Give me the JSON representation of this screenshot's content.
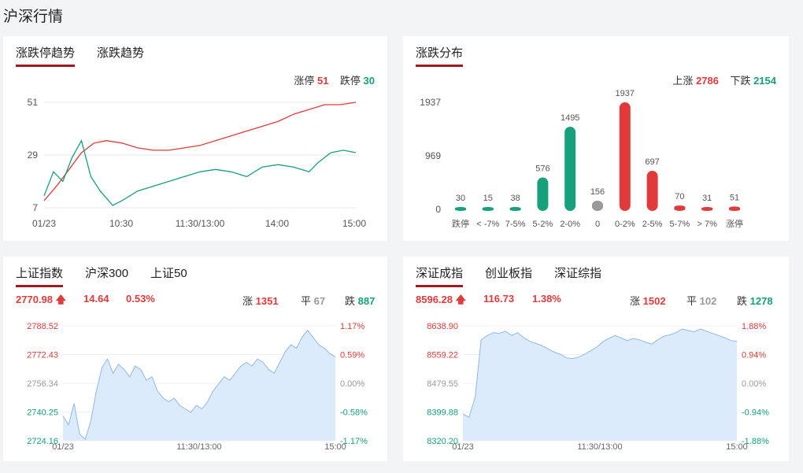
{
  "page_title": "沪深行情",
  "panel1": {
    "tabs": [
      "涨跌停趋势",
      "涨跌趋势"
    ],
    "limit_up_label": "涨停",
    "limit_up_value": "51",
    "limit_down_label": "跌停",
    "limit_down_value": "30",
    "chart_data": {
      "type": "line",
      "yticks": [
        "51",
        "29",
        "7"
      ],
      "xticks": [
        "01/23",
        "10:30",
        "11:30/13:00",
        "14:00",
        "15:00"
      ],
      "ylim": [
        7,
        51
      ],
      "series": [
        {
          "color": "#e03a3a",
          "x": [
            0,
            0.04,
            0.08,
            0.12,
            0.16,
            0.2,
            0.25,
            0.3,
            0.35,
            0.4,
            0.45,
            0.5,
            0.55,
            0.6,
            0.65,
            0.7,
            0.75,
            0.8,
            0.85,
            0.9,
            0.95,
            1.0
          ],
          "y": [
            10,
            16,
            23,
            30,
            34,
            35,
            34,
            32,
            31,
            31,
            32,
            33,
            35,
            37,
            39,
            41,
            43,
            46,
            48,
            50,
            50,
            51
          ]
        },
        {
          "color": "#16a07c",
          "x": [
            0,
            0.03,
            0.06,
            0.09,
            0.12,
            0.15,
            0.18,
            0.22,
            0.25,
            0.3,
            0.35,
            0.4,
            0.45,
            0.5,
            0.55,
            0.6,
            0.65,
            0.7,
            0.75,
            0.8,
            0.85,
            0.88,
            0.92,
            0.96,
            1.0
          ],
          "y": [
            12,
            22,
            18,
            28,
            35,
            20,
            14,
            8,
            10,
            14,
            16,
            18,
            20,
            22,
            23,
            22,
            20,
            24,
            25,
            24,
            22,
            26,
            30,
            31,
            30
          ]
        }
      ]
    }
  },
  "panel2": {
    "tab": "涨跌分布",
    "up_label": "上涨",
    "up_value": "2786",
    "down_label": "下跌",
    "down_value": "2154",
    "chart_data": {
      "type": "bar",
      "categories": [
        "跌停",
        "< -7%",
        "7-5%",
        "5-2%",
        "2-0%",
        "0",
        "0-2%",
        "2-5%",
        "5-7%",
        "> 7%",
        "涨停"
      ],
      "values": [
        30,
        15,
        38,
        576,
        1495,
        156,
        1937,
        697,
        70,
        31,
        51
      ],
      "yticks": [
        "1937",
        "969",
        "0"
      ],
      "ylim": [
        0,
        1937
      ],
      "colors": [
        "#16a07c",
        "#16a07c",
        "#16a07c",
        "#16a07c",
        "#16a07c",
        "#999999",
        "#e03a3a",
        "#e03a3a",
        "#e03a3a",
        "#e03a3a",
        "#e03a3a"
      ]
    }
  },
  "panel3": {
    "tabs": [
      "上证指数",
      "沪深300",
      "上证50"
    ],
    "price": "2770.98",
    "change": "14.64",
    "pct": "0.53%",
    "up_label": "涨",
    "up_value": "1351",
    "flat_label": "平",
    "flat_value": "67",
    "down_label": "跌",
    "down_value": "887",
    "chart_data": {
      "type": "area",
      "yticks_left": [
        "2788.52",
        "2772.43",
        "2756.34",
        "2740.25",
        "2724.16"
      ],
      "yticks_right": [
        "1.17%",
        "0.59%",
        "0.00%",
        "-0.58%",
        "-1.17%"
      ],
      "xticks": [
        "01/23",
        "11:30/13:00",
        "15:00"
      ],
      "ylim": [
        2724.16,
        2788.52
      ],
      "values": [
        2738,
        2733,
        2745,
        2728,
        2725,
        2735,
        2752,
        2765,
        2770,
        2762,
        2767,
        2764,
        2760,
        2766,
        2764,
        2758,
        2760,
        2752,
        2748,
        2746,
        2748,
        2744,
        2742,
        2740,
        2744,
        2742,
        2746,
        2752,
        2756,
        2760,
        2758,
        2762,
        2766,
        2768,
        2766,
        2770,
        2768,
        2764,
        2762,
        2768,
        2774,
        2778,
        2776,
        2782,
        2786,
        2782,
        2778,
        2776,
        2773,
        2771
      ]
    }
  },
  "panel4": {
    "tabs": [
      "深证成指",
      "创业板指",
      "深证综指"
    ],
    "price": "8596.28",
    "change": "116.73",
    "pct": "1.38%",
    "up_label": "涨",
    "up_value": "1502",
    "flat_label": "平",
    "flat_value": "102",
    "down_label": "跌",
    "down_value": "1278",
    "chart_data": {
      "type": "area",
      "yticks_left": [
        "8638.90",
        "8559.22",
        "8479.55",
        "8399.88",
        "8320.20"
      ],
      "yticks_right": [
        "1.88%",
        "0.94%",
        "0.00%",
        "-0.94%",
        "-1.88%"
      ],
      "xticks": [
        "01/23",
        "11:30/13:00",
        "15:00"
      ],
      "ylim": [
        8320.2,
        8638.9
      ],
      "values": [
        8395,
        8385,
        8440,
        8600,
        8612,
        8620,
        8618,
        8624,
        8612,
        8620,
        8606,
        8596,
        8590,
        8584,
        8575,
        8566,
        8560,
        8550,
        8548,
        8552,
        8560,
        8570,
        8580,
        8595,
        8604,
        8612,
        8605,
        8598,
        8604,
        8600,
        8594,
        8588,
        8600,
        8610,
        8614,
        8620,
        8630,
        8626,
        8622,
        8630,
        8624,
        8618,
        8612,
        8606,
        8598,
        8596
      ]
    }
  }
}
